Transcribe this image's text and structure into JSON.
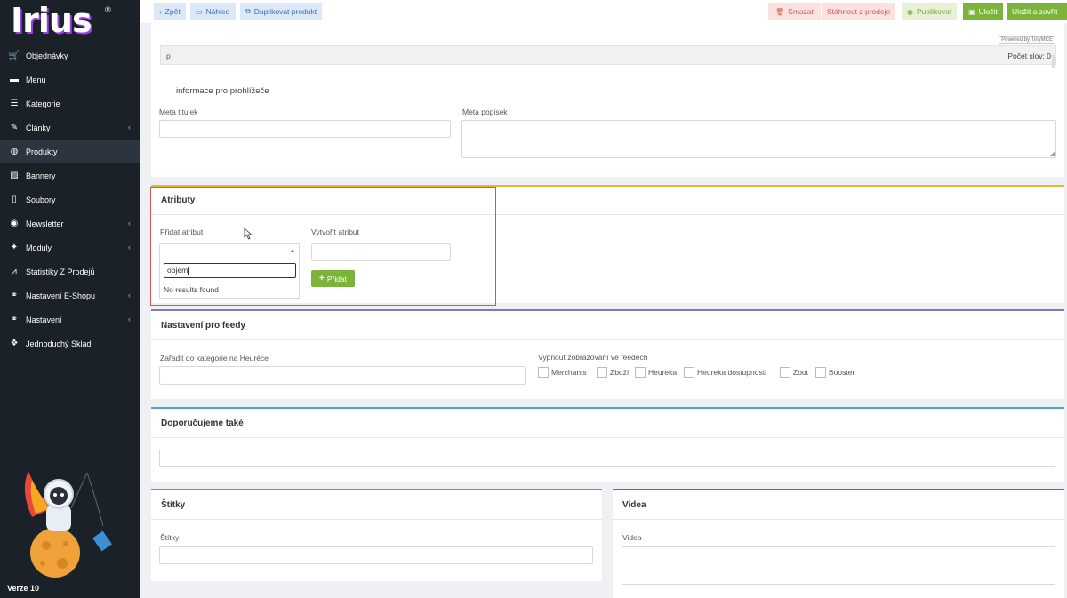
{
  "sidebar": {
    "logo": "Irius",
    "items": [
      {
        "label": "Objednávky",
        "icon": "cart-icon",
        "chev": false
      },
      {
        "label": "Menu",
        "icon": "folder-icon",
        "chev": false
      },
      {
        "label": "Kategorie",
        "icon": "list-icon",
        "chev": false
      },
      {
        "label": "Články",
        "icon": "pencil-icon",
        "chev": true
      },
      {
        "label": "Produkty",
        "icon": "globe-icon",
        "chev": false,
        "active": true
      },
      {
        "label": "Bannery",
        "icon": "image-icon",
        "chev": false
      },
      {
        "label": "Soubory",
        "icon": "file-icon",
        "chev": false
      },
      {
        "label": "Newsletter",
        "icon": "newsletter-icon",
        "chev": true
      },
      {
        "label": "Moduly",
        "icon": "bird-icon",
        "chev": true
      },
      {
        "label": "Statistiky Z Prodejů",
        "icon": "chart-icon",
        "chev": false
      },
      {
        "label": "Nastavení E-Shopu",
        "icon": "nodes-icon",
        "chev": true
      },
      {
        "label": "Nastavení",
        "icon": "nodes-icon",
        "chev": true
      },
      {
        "label": "Jednoduchý Sklad",
        "icon": "boxes-icon",
        "chev": false
      }
    ],
    "version": "Verze 10"
  },
  "toolbar": {
    "back": "Zpět",
    "preview": "Náhled",
    "duplicate": "Duplikovat produkt",
    "delete": "Smazat",
    "unpublish": "Stáhnout z prodeje",
    "publish": "Publikovat",
    "save": "Uložit",
    "save_close": "Uložit a zavřít"
  },
  "editor": {
    "powered": "Powered by TinyMCE",
    "path": "p",
    "wordcount": "Počet slov: 0"
  },
  "meta": {
    "heading": "informace pro prohlížeče",
    "title_label": "Meta titulek",
    "desc_label": "Meta popisek"
  },
  "attributes": {
    "title": "Atributy",
    "add_label": "Přidat atribut",
    "search_value": "objem",
    "no_results": "No results found",
    "create_label": "Vytvořit atribut",
    "add_button": "Přidat"
  },
  "feeds": {
    "title": "Nastavení pro feedy",
    "heureka_label": "Zařadit do kategorie na Heuréce",
    "disable_label": "Vypnout zobrazování ve feedech",
    "options": [
      "Merchants",
      "Zboží",
      "Heureka",
      "Heureka dostupnosti",
      "Zoot",
      "Booster"
    ]
  },
  "recommend": {
    "title": "Doporučujeme také"
  },
  "tags": {
    "title": "Štítky",
    "label": "Štítky"
  },
  "videos": {
    "title": "Videa",
    "label": "Videa"
  },
  "colors": {
    "sidebar": "#1b2128",
    "accent_green": "#7cb33b",
    "highlight_red": "#d9534f",
    "attr_border": "#f0b429",
    "feed_border": "#8e6fc4",
    "recommend_border": "#4ba3d6",
    "tags_border": "#c85fc2",
    "videos_border": "#3a78c9"
  }
}
